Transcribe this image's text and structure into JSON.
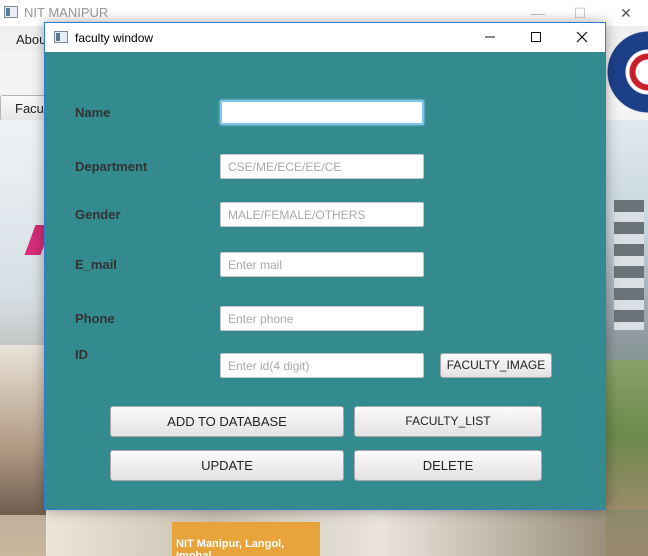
{
  "main_window": {
    "title": "NIT MANIPUR",
    "menu_item": "Abou",
    "tab_button": "Facult",
    "caption": "NIT Manipur, Langol, Imphal",
    "controls": {
      "minimize": "—",
      "maximize": "☐",
      "close": "✕"
    }
  },
  "dialog": {
    "title": "faculty window",
    "controls": {
      "minimize": "—",
      "maximize": "☐",
      "close": "✕"
    },
    "fields": {
      "name": {
        "label": "Name",
        "value": "",
        "placeholder": ""
      },
      "department": {
        "label": "Department",
        "placeholder": "CSE/ME/ECE/EE/CE"
      },
      "gender": {
        "label": "Gender",
        "placeholder": "MALE/FEMALE/OTHERS"
      },
      "email": {
        "label": "E_mail",
        "placeholder": "Enter mail"
      },
      "phone": {
        "label": "Phone",
        "placeholder": "Enter phone"
      },
      "id": {
        "label": "ID",
        "placeholder": "Enter id(4 digit)"
      }
    },
    "buttons": {
      "faculty_image": "FACULTY_IMAGE",
      "add": "ADD TO DATABASE",
      "list": "FACULTY_LIST",
      "update": "UPDATE",
      "delete": "DELETE"
    }
  },
  "colors": {
    "dialog_background": "#338b8f",
    "label_text": "#333333",
    "focus_border": "#7fc6ee"
  }
}
